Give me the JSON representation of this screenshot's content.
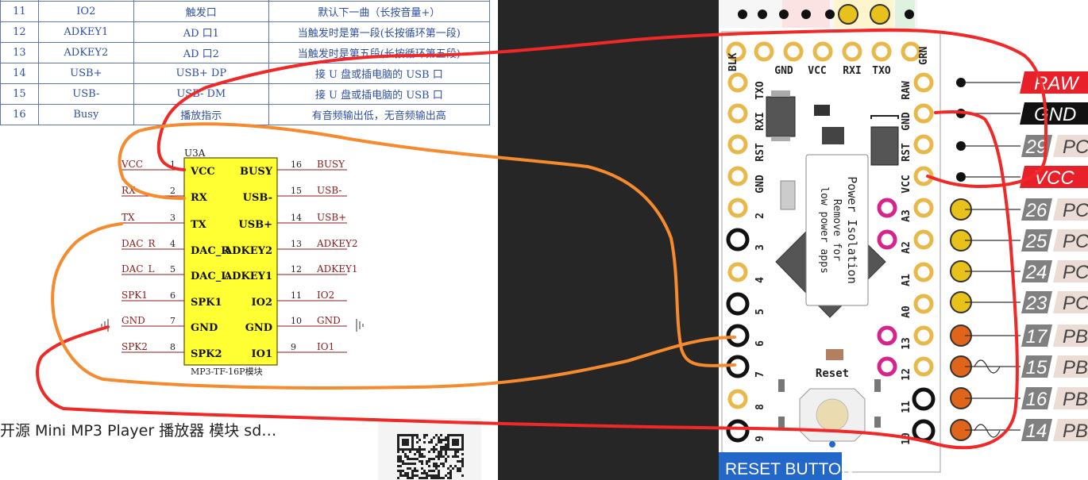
{
  "pin_table": {
    "rows": [
      {
        "num": "11",
        "name": "IO2",
        "func": "触发口",
        "desc": "默认下一曲（长按音量+）"
      },
      {
        "num": "12",
        "name": "ADKEY1",
        "func": "AD 口1",
        "desc": "当触发时是第一段(长按循环第一段)"
      },
      {
        "num": "13",
        "name": "ADKEY2",
        "func": "AD 口2",
        "desc": "当触发时是第五段(长按循环第五段)"
      },
      {
        "num": "14",
        "name": "USB+",
        "func": "USB+ DP",
        "desc": "接 U 盘或插电脑的 USB 口"
      },
      {
        "num": "15",
        "name": "USB-",
        "func": "USB- DM",
        "desc": "接 U 盘或插电脑的 USB 口"
      },
      {
        "num": "16",
        "name": "Busy",
        "func": "播放指示",
        "desc": "有音频输出低，无音频输出高"
      }
    ]
  },
  "schematic": {
    "ref": "U3A",
    "part": "MP3-TF-16P模块",
    "left_pins": [
      {
        "n": "1",
        "pin": "VCC",
        "net": "VCC"
      },
      {
        "n": "2",
        "pin": "RX",
        "net": "RX"
      },
      {
        "n": "3",
        "pin": "TX",
        "net": "TX"
      },
      {
        "n": "4",
        "pin": "DAC_R",
        "net": "DAC_R"
      },
      {
        "n": "5",
        "pin": "DAC_L",
        "net": "DAC_L"
      },
      {
        "n": "6",
        "pin": "SPK1",
        "net": "SPK1"
      },
      {
        "n": "7",
        "pin": "GND",
        "net": "GND"
      },
      {
        "n": "8",
        "pin": "SPK2",
        "net": "SPK2"
      }
    ],
    "right_pins": [
      {
        "n": "16",
        "pin": "BUSY",
        "net": "BUSY"
      },
      {
        "n": "15",
        "pin": "USB-",
        "net": "USB-"
      },
      {
        "n": "14",
        "pin": "USB+",
        "net": "USB+"
      },
      {
        "n": "13",
        "pin": "ADKEY2",
        "net": "ADKEY2"
      },
      {
        "n": "12",
        "pin": "ADKEY1",
        "net": "ADKEY1"
      },
      {
        "n": "11",
        "pin": "IO2",
        "net": "IO2"
      },
      {
        "n": "10",
        "pin": "GND",
        "net": "GND"
      },
      {
        "n": "9",
        "pin": "IO1",
        "net": "IO1"
      }
    ]
  },
  "caption": "开源 Mini MP3 Player 播放器 模块 sd…",
  "board": {
    "top_labels": [
      "BLK",
      "GND",
      "VCC",
      "RXI",
      "TXO",
      "GRN"
    ],
    "left_labels": [
      "TXO",
      "RXI",
      "RST",
      "GND",
      "2",
      "3",
      "4",
      "5",
      "6",
      "7",
      "8",
      "9"
    ],
    "right_labels": [
      "RAW",
      "GND",
      "RST",
      "VCC",
      "A3",
      "A2",
      "A1",
      "A0",
      "13",
      "12",
      "11",
      "10"
    ],
    "silk_text": [
      "Power Isolation",
      "Remove for",
      "low power apps"
    ],
    "reset_label": "Reset",
    "reset_button_label": "RESET BUTTON",
    "tags": [
      {
        "num": "",
        "label": "RAW",
        "style": "red"
      },
      {
        "num": "",
        "label": "GND",
        "style": "black"
      },
      {
        "num": "29",
        "label": "PC",
        "style": "gray"
      },
      {
        "num": "",
        "label": "VCC",
        "style": "red"
      },
      {
        "num": "26",
        "label": "PC",
        "style": "gray"
      },
      {
        "num": "25",
        "label": "PC",
        "style": "gray"
      },
      {
        "num": "24",
        "label": "PC",
        "style": "gray"
      },
      {
        "num": "23",
        "label": "PC",
        "style": "gray"
      },
      {
        "num": "17",
        "label": "PB",
        "style": "gray"
      },
      {
        "num": "15",
        "label": "PB",
        "style": "gray"
      },
      {
        "num": "16",
        "label": "PB",
        "style": "gray"
      },
      {
        "num": "14",
        "label": "PB",
        "style": "gray"
      }
    ]
  },
  "colors": {
    "table_text": "#2d4ea2",
    "schem_box": "#ffff33",
    "schem_net": "#8b1a1a",
    "board_gold": "#e8b94a",
    "board_magenta": "#d6248c",
    "board_chip": "#555555",
    "wire_red": "#f02828",
    "wire_orange": "#f58a2e",
    "reset_blue": "#2367c8",
    "dark_panel": "#262626"
  }
}
